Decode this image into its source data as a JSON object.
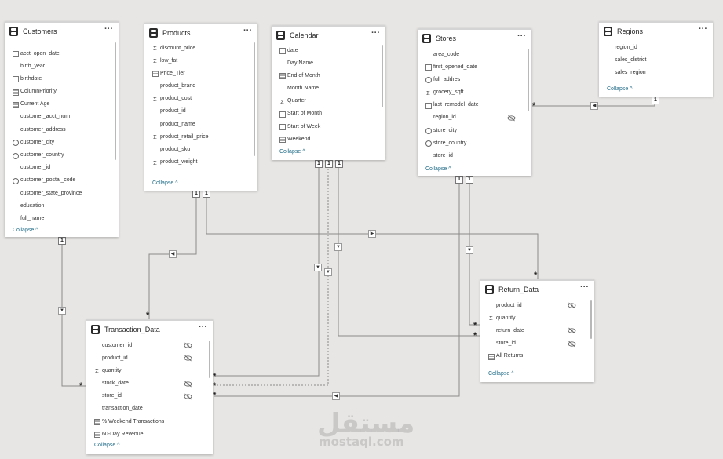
{
  "tables": {
    "customers": {
      "title": "Customers",
      "menu": "···",
      "collapse": "Collapse",
      "fields": [
        {
          "name": "acct_open_date",
          "icon": "calendar-icon"
        },
        {
          "name": "birth_year",
          "icon": ""
        },
        {
          "name": "birthdate",
          "icon": "calendar-icon"
        },
        {
          "name": "ColumnPriority",
          "icon": "calculated-column-icon"
        },
        {
          "name": "Current Age",
          "icon": "calculated-column-icon"
        },
        {
          "name": "customer_acct_num",
          "icon": ""
        },
        {
          "name": "customer_address",
          "icon": ""
        },
        {
          "name": "customer_city",
          "icon": "globe-icon"
        },
        {
          "name": "customer_country",
          "icon": "globe-icon"
        },
        {
          "name": "customer_id",
          "icon": ""
        },
        {
          "name": "customer_postal_code",
          "icon": "globe-icon"
        },
        {
          "name": "customer_state_province",
          "icon": ""
        },
        {
          "name": "education",
          "icon": ""
        },
        {
          "name": "full_name",
          "icon": ""
        }
      ]
    },
    "products": {
      "title": "Products",
      "menu": "···",
      "collapse": "Collapse",
      "fields": [
        {
          "name": "discount_price",
          "icon": "sigma-icon"
        },
        {
          "name": "low_fat",
          "icon": "sigma-icon"
        },
        {
          "name": "Price_Tier",
          "icon": "calculated-column-icon"
        },
        {
          "name": "product_brand",
          "icon": ""
        },
        {
          "name": "product_cost",
          "icon": "sigma-icon"
        },
        {
          "name": "product_id",
          "icon": ""
        },
        {
          "name": "product_name",
          "icon": ""
        },
        {
          "name": "product_retail_price",
          "icon": "sigma-icon"
        },
        {
          "name": "product_sku",
          "icon": ""
        },
        {
          "name": "product_weight",
          "icon": "sigma-icon"
        }
      ]
    },
    "calendar": {
      "title": "Calendar",
      "menu": "···",
      "collapse": "Collapse",
      "fields": [
        {
          "name": "date",
          "icon": "calendar-icon"
        },
        {
          "name": "Day Name",
          "icon": ""
        },
        {
          "name": "End of Month",
          "icon": "calculated-column-icon"
        },
        {
          "name": "Month Name",
          "icon": ""
        },
        {
          "name": "Quarter",
          "icon": "sigma-icon"
        },
        {
          "name": "Start of Month",
          "icon": "calendar-icon"
        },
        {
          "name": "Start of Week",
          "icon": "calendar-icon"
        },
        {
          "name": "Weekend",
          "icon": "calculated-column-icon"
        }
      ]
    },
    "stores": {
      "title": "Stores",
      "menu": "···",
      "collapse": "Collapse",
      "fields": [
        {
          "name": "area_code",
          "icon": ""
        },
        {
          "name": "first_opened_date",
          "icon": "calendar-icon"
        },
        {
          "name": "full_addres",
          "icon": "globe-icon"
        },
        {
          "name": "grocery_sqft",
          "icon": "sigma-icon"
        },
        {
          "name": "last_remodel_date",
          "icon": "calendar-icon"
        },
        {
          "name": "region_id",
          "icon": "",
          "hidden": true
        },
        {
          "name": "store_city",
          "icon": "globe-icon"
        },
        {
          "name": "store_country",
          "icon": "globe-icon"
        },
        {
          "name": "store_id",
          "icon": ""
        }
      ]
    },
    "regions": {
      "title": "Regions",
      "menu": "···",
      "collapse": "Collapse",
      "fields": [
        {
          "name": "region_id",
          "icon": ""
        },
        {
          "name": "sales_district",
          "icon": ""
        },
        {
          "name": "sales_region",
          "icon": ""
        }
      ]
    },
    "transaction_data": {
      "title": "Transaction_Data",
      "menu": "···",
      "collapse": "Collapse",
      "fields": [
        {
          "name": "customer_id",
          "icon": "",
          "hidden": true
        },
        {
          "name": "product_id",
          "icon": "",
          "hidden": true
        },
        {
          "name": "quantity",
          "icon": "sigma-icon"
        },
        {
          "name": "stock_date",
          "icon": "",
          "hidden": true
        },
        {
          "name": "store_id",
          "icon": "",
          "hidden": true
        },
        {
          "name": "transaction_date",
          "icon": ""
        },
        {
          "name": "% Weekend Transactions",
          "icon": "measure-icon"
        },
        {
          "name": "60-Day Revenue",
          "icon": "measure-icon"
        }
      ]
    },
    "return_data": {
      "title": "Return_Data",
      "menu": "···",
      "collapse": "Collapse",
      "fields": [
        {
          "name": "product_id",
          "icon": "",
          "hidden": true
        },
        {
          "name": "quantity",
          "icon": "sigma-icon"
        },
        {
          "name": "return_date",
          "icon": "",
          "hidden": true
        },
        {
          "name": "store_id",
          "icon": "",
          "hidden": true
        },
        {
          "name": "All Returns",
          "icon": "measure-icon"
        }
      ]
    }
  },
  "relationships": {
    "one_label": "1",
    "many_label": "*"
  },
  "watermark": {
    "arabic": "مستقل",
    "latin": "mostaql.com"
  }
}
